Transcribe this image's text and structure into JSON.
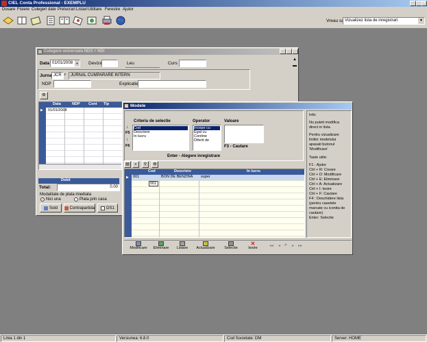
{
  "app": {
    "title": "CIEL Conta Professional - EXEMPLU",
    "menu": [
      "Dosare",
      "Fisiere",
      "Culegeri date",
      "Prelucrari",
      "Listari",
      "Utilitare",
      "Ferestre",
      "Ajutor"
    ],
    "view_label": "Vreau sa:",
    "view_value": "Vizualizez lista de inregistrari"
  },
  "doc_window": {
    "title": "Culegere universala NDS = NDI",
    "data_label": "Data",
    "data_value": "01/01/2008",
    "deviza_label": "Deviza",
    "deviza_value": "",
    "leu": "Leu",
    "curs_label": "Curs",
    "curs_value": "",
    "jurnal_label": "Jurnal",
    "jurnal_code": "JCR",
    "jurnal_name": "JURNAL CUMPARARE INTERN",
    "ndp_label": "NDP",
    "explicatie_label": "Explicatie",
    "columns": [
      "Data",
      "NDP",
      "Cont",
      "Tip"
    ],
    "rows": [
      [
        "01/01/2008",
        "",
        "",
        ""
      ]
    ],
    "debit_label": "Debit",
    "total_label": "Total:",
    "total_value": "0.00",
    "modalitate_label": "Modalitate de plata imediata",
    "radio_nici": "Nici una",
    "radio_casa": "Plata prin casa",
    "btn_sold": "Sold",
    "btn_contrapartida": "Contrapartida",
    "btn_ds": "DS1"
  },
  "modele": {
    "title": "Modele",
    "criteriu_label": "Criteriu de selectie",
    "criteriu_items": [
      "Cod",
      "Descriere",
      "In lucru"
    ],
    "operator_label": "Operator",
    "operator_items": [
      "Incepe cu",
      "Egal cu",
      "Contine",
      "Diferit de"
    ],
    "valoare_label": "Valoare",
    "f3_label": "F3 - Cautare",
    "f5": "F5",
    "f6": "F6",
    "enter_label": "Enter - Alegere inregistrare",
    "columns": [
      "Cod",
      "Descriere",
      "In lucru"
    ],
    "rows": [
      [
        "001",
        "BON DE BENZINA",
        "super"
      ],
      [
        "",
        "001",
        ""
      ]
    ],
    "buttons": [
      "Modificare",
      "Eliminare",
      "Listare",
      "Actualizare",
      "Selectie",
      "Iesire"
    ],
    "info_title": "Info:",
    "info_text1": "Nu puteti modifica direct in lista.",
    "info_text2": "Pentru vizualizare liniilor modelului apasati butonul 'Modificare'",
    "taste_title": "Taste utile:",
    "taste": [
      "F1 : Ajutor",
      "Ctrl + R: Creare",
      "Ctrl + D: Modificare",
      "Ctrl + E: Eliminare",
      "Ctrl + A: Actualizare",
      "Ctrl + I: Iesire",
      "Ctrl + F: Cautare",
      "F4 : Deschidere lista (pentru casetele marcate cu iconita de cautare)",
      "Enter: Selectie"
    ]
  },
  "statusbar": {
    "linia": "Linia 1 din 1",
    "versiunea": "Versiunea: 6.8.0",
    "cod_societate": "Cod Societate: DM",
    "server": "Server: HOME"
  }
}
